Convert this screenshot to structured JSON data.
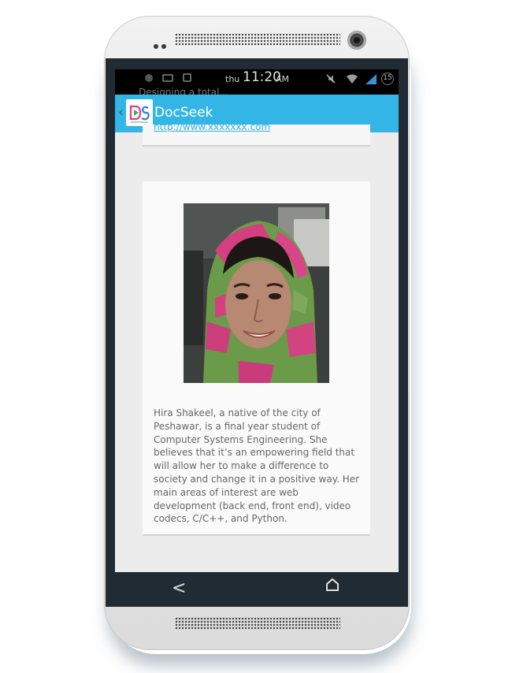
{
  "status_bar": {
    "day": "thu",
    "time": "11:20",
    "ampm": "AM",
    "notification_ghost": "Designing a total...",
    "battery": "15"
  },
  "action_bar": {
    "title": "DocSeek",
    "accent_color": "#33b5e5"
  },
  "previous_card": {
    "link_text": "http://www.xxxxxxx.com"
  },
  "profile_card": {
    "photo_alt": "Hira Shakeel",
    "bio": "Hira Shakeel, a native of the city of Peshawar, is a final year student of Computer Systems Engineering. She believes that it’s an empowering field that will allow her to make a difference to society and change it in a positive way. Her main areas of interest are web development (back end, front end), video codecs, C/C++, and Python."
  },
  "icons": {
    "up": "chevron-left-icon",
    "logo": "docseek-logo-icon",
    "back": "back-arrow-icon",
    "home": "home-icon",
    "wifi": "wifi-icon",
    "signal": "signal-icon",
    "mute": "mute-icon"
  }
}
